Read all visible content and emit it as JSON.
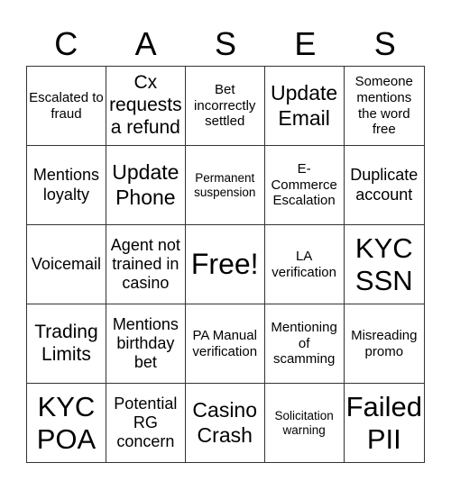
{
  "header": {
    "letters": [
      "C",
      "A",
      "S",
      "E",
      "S"
    ]
  },
  "card": {
    "rows": [
      [
        "Escalated to fraud",
        "Cx requests a refund",
        "Bet incorrectly settled",
        "Update Email",
        "Someone mentions the word free"
      ],
      [
        "Mentions loyalty",
        "Update Phone",
        "Permanent suspension",
        "E-Commerce Escalation",
        "Duplicate account"
      ],
      [
        "Voicemail",
        "Agent not trained in casino",
        "Free!",
        "LA verification",
        "KYC SSN"
      ],
      [
        "Trading Limits",
        "Mentions birthday bet",
        "PA Manual verification",
        "Mentioning of scamming",
        "Misreading promo"
      ],
      [
        "KYC POA",
        "Potential RG concern",
        "Casino Crash",
        "Solicitation warning",
        "Failed PII"
      ]
    ]
  }
}
